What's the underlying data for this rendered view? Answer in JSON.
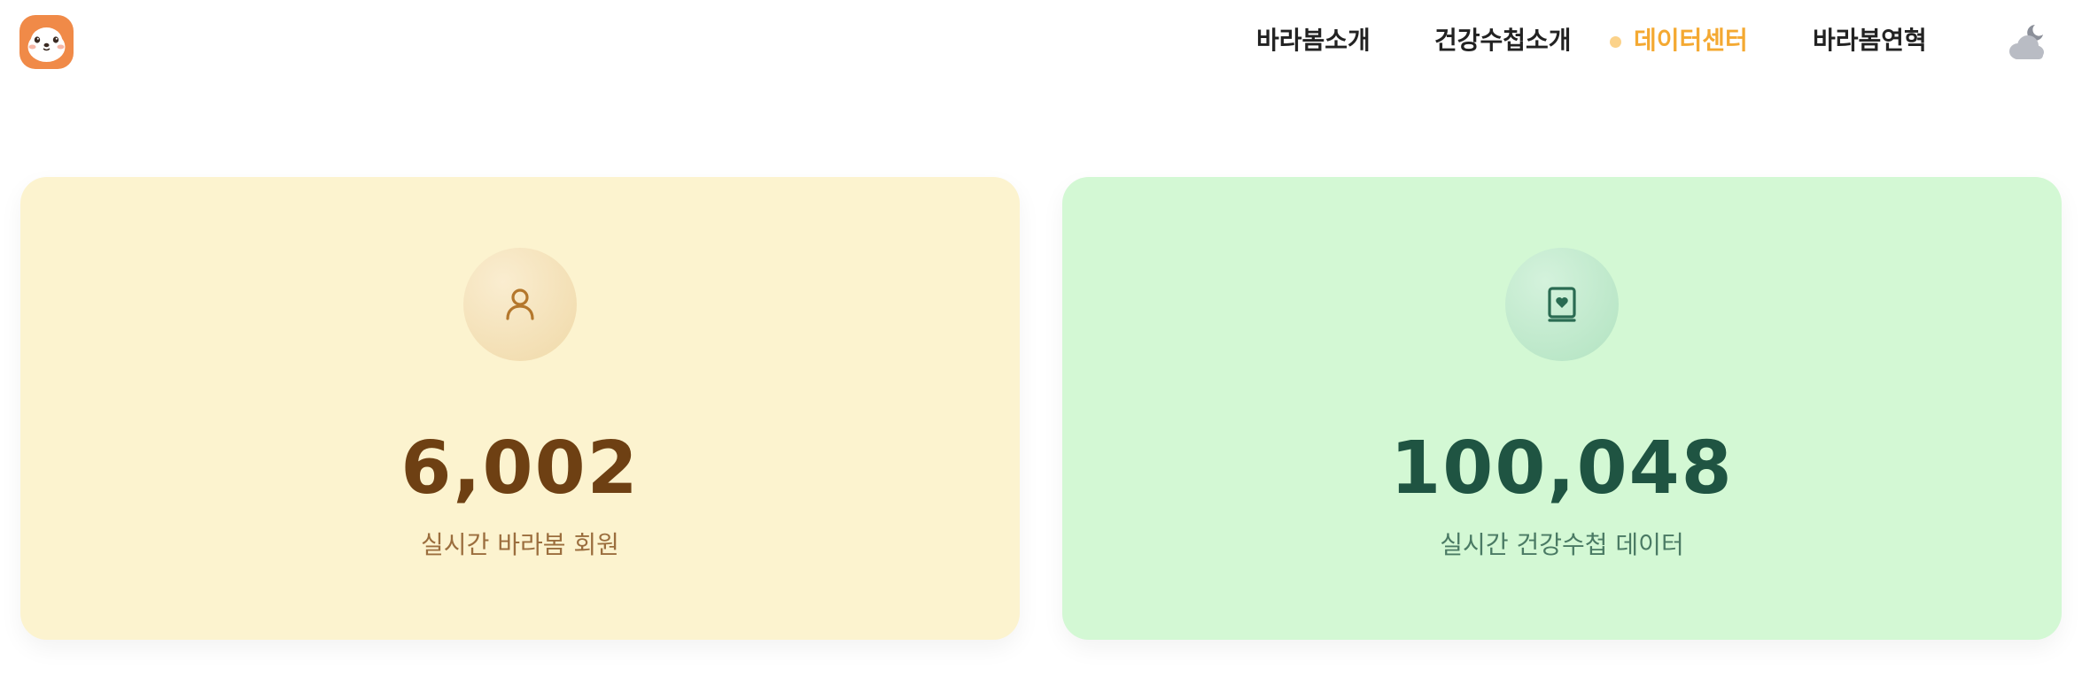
{
  "header": {
    "nav": [
      {
        "label": "바라봄소개"
      },
      {
        "label": "건강수첩소개"
      },
      {
        "label": "데이터센터",
        "active": true
      },
      {
        "label": "바라봄연혁"
      }
    ],
    "logo_icon": "seal-mascot-logo",
    "theme_toggle_icon": "cloud-moon-icon"
  },
  "stats": [
    {
      "value": "6,002",
      "label": "실시간 바라봄 회원",
      "icon": "user-icon"
    },
    {
      "value": "100,048",
      "label": "실시간 건강수첩 데이터",
      "icon": "health-book-icon"
    }
  ],
  "colors": {
    "accent": "#f4a932",
    "card_left_bg": "#fcf3cf",
    "card_right_bg": "#d3f8d4",
    "value_left": "#6e4013",
    "value_right": "#1f5442",
    "logo_bg": "#f08a48"
  }
}
